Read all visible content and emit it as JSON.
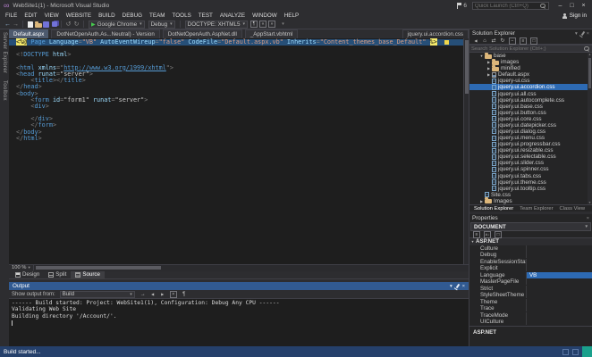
{
  "colors": {
    "accent": "#007acc",
    "editor_selection": "#264f78",
    "tree_selection": "#2d6ab3",
    "directive_tag_bg": "#f3e96b",
    "output_header": "#315a91",
    "status_bar": "#25406b"
  },
  "icons": {
    "vs_logo": "∞",
    "chevron_down": "▾",
    "back": "←",
    "forward": "→",
    "undo": "↺",
    "redo": "↻",
    "play": "▶",
    "home": "⌂",
    "switch_views": "⇄",
    "refresh": "↻",
    "collapse_all": "−",
    "show_all_files": "≡",
    "prev_message": "◀",
    "next_message": "▶",
    "clear_all": "×",
    "word_wrap": "¶",
    "goto_source": "→",
    "categorized": "≡",
    "alphabetical": "A↓",
    "property_pages": "□",
    "expanded": "▼",
    "collapsed": "▶",
    "scroll_up": "▲",
    "scroll_down": "▼",
    "close": "×",
    "overflow": "▾"
  },
  "title_bar": {
    "title": "WebSite1(1) - Microsoft Visual Studio",
    "notification_count": "6",
    "quick_launch_placeholder": "Quick Launch (Ctrl+Q)",
    "minimize": "–",
    "maximize": "□",
    "close": "×"
  },
  "menu_bar": {
    "items": [
      "FILE",
      "EDIT",
      "VIEW",
      "WEBSITE",
      "BUILD",
      "DEBUG",
      "TEAM",
      "TOOLS",
      "TEST",
      "ANALYZE",
      "WINDOW",
      "HELP"
    ],
    "sign_in": "Sign in"
  },
  "toolbar": {
    "run_target": "Google Chrome",
    "configuration": "Debug",
    "doctype": "DOCTYPE: XHTML5"
  },
  "side_strip": {
    "tabs": [
      "Server Explorer",
      "Toolbox"
    ]
  },
  "document_well": {
    "tabs": [
      {
        "label": "Default.aspx",
        "state": "active"
      },
      {
        "label": "DotNetOpenAuth.As...Neutral) - Version",
        "state": "inactive"
      },
      {
        "label": "DotNetOpenAuth.AspNet.dll",
        "state": "inactive"
      },
      {
        "label": "_AppStart.vbhtml",
        "state": "inactive"
      },
      {
        "label": "jquery.ui.accordion.css",
        "state": "preview"
      }
    ]
  },
  "editor": {
    "zoom": "100 %",
    "views": [
      "Design",
      "Split",
      "Source"
    ],
    "active_view": "Source",
    "code_lines": [
      {
        "selected": true,
        "marker": "warning",
        "tokens": [
          {
            "t": "<%@",
            "c": "asp"
          },
          {
            "t": " ",
            "c": "pl"
          },
          {
            "t": "Page",
            "c": "tag"
          },
          {
            "t": " ",
            "c": "pl"
          },
          {
            "t": "Language",
            "c": "attr"
          },
          {
            "t": "=",
            "c": "pl"
          },
          {
            "t": "\"VB\"",
            "c": "dstr"
          },
          {
            "t": " ",
            "c": "pl"
          },
          {
            "t": "AutoEventWireup",
            "c": "attr"
          },
          {
            "t": "=",
            "c": "pl"
          },
          {
            "t": "\"false\"",
            "c": "dstr"
          },
          {
            "t": " ",
            "c": "pl"
          },
          {
            "t": "CodeFile",
            "c": "attr"
          },
          {
            "t": "=",
            "c": "pl"
          },
          {
            "t": "\"Default.aspx.vb\"",
            "c": "dstr"
          },
          {
            "t": " ",
            "c": "pl"
          },
          {
            "t": "Inherits",
            "c": "attr"
          },
          {
            "t": "=",
            "c": "pl"
          },
          {
            "t": "\"Content_themes_base_Default\"",
            "c": "dstr"
          },
          {
            "t": " ",
            "c": "pl"
          },
          {
            "t": "%>",
            "c": "asp"
          }
        ]
      },
      {
        "tokens": []
      },
      {
        "tokens": [
          {
            "t": "<!",
            "c": "pl"
          },
          {
            "t": "DOCTYPE",
            "c": "tag"
          },
          {
            "t": " ",
            "c": "pl"
          },
          {
            "t": "html",
            "c": "attr"
          },
          {
            "t": ">",
            "c": "pl"
          }
        ]
      },
      {
        "tokens": []
      },
      {
        "tokens": [
          {
            "t": "<",
            "c": "pl"
          },
          {
            "t": "html",
            "c": "tag"
          },
          {
            "t": " ",
            "c": "pl"
          },
          {
            "t": "xmlns",
            "c": "attr"
          },
          {
            "t": "=\"",
            "c": "pl"
          },
          {
            "t": "http://www.w3.org/1999/xhtml",
            "c": "url"
          },
          {
            "t": "\"",
            "c": "pl"
          },
          {
            "t": ">",
            "c": "pl"
          }
        ]
      },
      {
        "tokens": [
          {
            "t": "<",
            "c": "pl"
          },
          {
            "t": "head",
            "c": "tag"
          },
          {
            "t": " ",
            "c": "pl"
          },
          {
            "t": "runat",
            "c": "attr"
          },
          {
            "t": "=",
            "c": "pl"
          },
          {
            "t": "\"server\"",
            "c": "str"
          },
          {
            "t": ">",
            "c": "pl"
          }
        ]
      },
      {
        "tokens": [
          {
            "t": "    ",
            "c": "pl"
          },
          {
            "t": "<",
            "c": "pl"
          },
          {
            "t": "title",
            "c": "tag"
          },
          {
            "t": "></",
            "c": "pl"
          },
          {
            "t": "title",
            "c": "tag"
          },
          {
            "t": ">",
            "c": "pl"
          }
        ]
      },
      {
        "tokens": [
          {
            "t": "</",
            "c": "pl"
          },
          {
            "t": "head",
            "c": "tag"
          },
          {
            "t": ">",
            "c": "pl"
          }
        ]
      },
      {
        "tokens": [
          {
            "t": "<",
            "c": "pl"
          },
          {
            "t": "body",
            "c": "tag"
          },
          {
            "t": ">",
            "c": "pl"
          }
        ]
      },
      {
        "tokens": [
          {
            "t": "    ",
            "c": "pl"
          },
          {
            "t": "<",
            "c": "pl"
          },
          {
            "t": "form",
            "c": "tag"
          },
          {
            "t": " ",
            "c": "pl"
          },
          {
            "t": "id",
            "c": "attr"
          },
          {
            "t": "=",
            "c": "pl"
          },
          {
            "t": "\"form1\"",
            "c": "str"
          },
          {
            "t": " ",
            "c": "pl"
          },
          {
            "t": "runat",
            "c": "attr"
          },
          {
            "t": "=",
            "c": "pl"
          },
          {
            "t": "\"server\"",
            "c": "str"
          },
          {
            "t": ">",
            "c": "pl"
          }
        ]
      },
      {
        "tokens": [
          {
            "t": "    ",
            "c": "pl"
          },
          {
            "t": "<",
            "c": "pl"
          },
          {
            "t": "div",
            "c": "tag"
          },
          {
            "t": ">",
            "c": "pl"
          }
        ]
      },
      {
        "tokens": []
      },
      {
        "tokens": [
          {
            "t": "    ",
            "c": "pl"
          },
          {
            "t": "</",
            "c": "pl"
          },
          {
            "t": "div",
            "c": "tag"
          },
          {
            "t": ">",
            "c": "pl"
          }
        ]
      },
      {
        "tokens": [
          {
            "t": "    ",
            "c": "pl"
          },
          {
            "t": "</",
            "c": "pl"
          },
          {
            "t": "form",
            "c": "tag"
          },
          {
            "t": ">",
            "c": "pl"
          }
        ]
      },
      {
        "tokens": [
          {
            "t": "</",
            "c": "pl"
          },
          {
            "t": "body",
            "c": "tag"
          },
          {
            "t": ">",
            "c": "pl"
          }
        ]
      },
      {
        "tokens": [
          {
            "t": "</",
            "c": "pl"
          },
          {
            "t": "html",
            "c": "tag"
          },
          {
            "t": ">",
            "c": "pl"
          }
        ]
      }
    ]
  },
  "output_panel": {
    "title": "Output",
    "show_output_from": "Show output from:",
    "source": "Build",
    "lines": [
      "------ Build started: Project: WebSite1(1), Configuration: Debug Any CPU ------",
      "Validating Web Site",
      "Building directory '/Account/'."
    ]
  },
  "solution_explorer": {
    "title": "Solution Explorer",
    "search_placeholder": "Search Solution Explorer (Ctrl+;)",
    "items": [
      {
        "label": "base",
        "type": "folder",
        "indent": 1,
        "arrow": "expanded"
      },
      {
        "label": "images",
        "type": "folder",
        "indent": 2,
        "arrow": "collapsed"
      },
      {
        "label": "minified",
        "type": "folder",
        "indent": 2,
        "arrow": "collapsed"
      },
      {
        "label": "Default.aspx",
        "type": "aspx",
        "indent": 2,
        "arrow": "collapsed"
      },
      {
        "label": "jquery-ui.css",
        "type": "css",
        "indent": 2
      },
      {
        "label": "jquery.ui.accordion.css",
        "type": "css",
        "indent": 2,
        "selected": true
      },
      {
        "label": "jquery.ui.all.css",
        "type": "css",
        "indent": 2
      },
      {
        "label": "jquery.ui.autocomplete.css",
        "type": "css",
        "indent": 2
      },
      {
        "label": "jquery.ui.base.css",
        "type": "css",
        "indent": 2
      },
      {
        "label": "jquery.ui.button.css",
        "type": "css",
        "indent": 2
      },
      {
        "label": "jquery.ui.core.css",
        "type": "css",
        "indent": 2
      },
      {
        "label": "jquery.ui.datepicker.css",
        "type": "css",
        "indent": 2
      },
      {
        "label": "jquery.ui.dialog.css",
        "type": "css",
        "indent": 2
      },
      {
        "label": "jquery.ui.menu.css",
        "type": "css",
        "indent": 2
      },
      {
        "label": "jquery.ui.progressbar.css",
        "type": "css",
        "indent": 2
      },
      {
        "label": "jquery.ui.resizable.css",
        "type": "css",
        "indent": 2
      },
      {
        "label": "jquery.ui.selectable.css",
        "type": "css",
        "indent": 2
      },
      {
        "label": "jquery.ui.slider.css",
        "type": "css",
        "indent": 2
      },
      {
        "label": "jquery.ui.spinner.css",
        "type": "css",
        "indent": 2
      },
      {
        "label": "jquery.ui.tabs.css",
        "type": "css",
        "indent": 2
      },
      {
        "label": "jquery.ui.theme.css",
        "type": "css",
        "indent": 2
      },
      {
        "label": "jquery.ui.tooltip.css",
        "type": "css",
        "indent": 2
      },
      {
        "label": "Site.css",
        "type": "css",
        "indent": 1
      },
      {
        "label": "Images",
        "type": "folder",
        "indent": 1,
        "arrow": "collapsed"
      }
    ],
    "bottom_tabs": [
      "Solution Explorer",
      "Team Explorer",
      "Class View"
    ]
  },
  "properties_panel": {
    "title": "Properties",
    "object_name": "DOCUMENT",
    "category": "ASP.NET",
    "rows": [
      {
        "name": "Culture",
        "value": ""
      },
      {
        "name": "Debug",
        "value": ""
      },
      {
        "name": "EnableSessionState",
        "value": ""
      },
      {
        "name": "Explicit",
        "value": ""
      },
      {
        "name": "Language",
        "value": "VB",
        "selected": true
      },
      {
        "name": "MasterPageFile",
        "value": ""
      },
      {
        "name": "Strict",
        "value": ""
      },
      {
        "name": "StyleSheetTheme",
        "value": ""
      },
      {
        "name": "Theme",
        "value": ""
      },
      {
        "name": "Trace",
        "value": ""
      },
      {
        "name": "TraceMode",
        "value": ""
      },
      {
        "name": "UICulture",
        "value": ""
      }
    ],
    "description": "ASP.NET"
  },
  "status_bar": {
    "text": "Build started..."
  }
}
